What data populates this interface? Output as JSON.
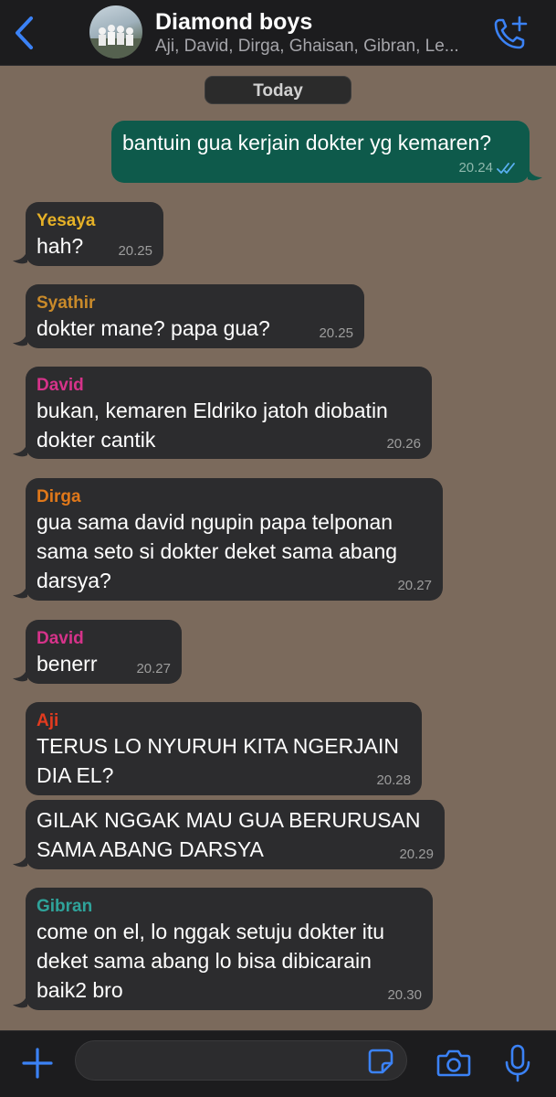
{
  "header": {
    "title": "Diamond boys",
    "subtitle": "Aji, David, Dirga, Ghaisan, Gibran, Le..."
  },
  "date_divider": "Today",
  "colors": {
    "accent": "#3b82f6",
    "yesaya": "#e6b127",
    "syathir": "#c98a2a",
    "david": "#d6338a",
    "dirga": "#e0781a",
    "aji": "#e23b1f",
    "gibran": "#2fa39a"
  },
  "messages": [
    {
      "id": "m1",
      "direction": "outgoing",
      "text": "bantuin gua kerjain dokter yg kemaren?",
      "time": "20.24",
      "status": "read"
    },
    {
      "id": "m2",
      "direction": "incoming",
      "sender": "Yesaya",
      "text": "hah?",
      "time": "20.25"
    },
    {
      "id": "m3",
      "direction": "incoming",
      "sender": "Syathir",
      "text": "dokter mane? papa gua?",
      "time": "20.25"
    },
    {
      "id": "m4",
      "direction": "incoming",
      "sender": "David",
      "text": "bukan, kemaren Eldriko jatoh diobatin\ndokter cantik",
      "time": "20.26"
    },
    {
      "id": "m5",
      "direction": "incoming",
      "sender": "Dirga",
      "text": "gua sama david ngupin papa telponan\nsama seto si dokter deket sama abang\ndarsya?",
      "time": "20.27"
    },
    {
      "id": "m6",
      "direction": "incoming",
      "sender": "David",
      "text": "benerr",
      "time": "20.27"
    },
    {
      "id": "m7",
      "direction": "incoming",
      "sender": "Aji",
      "text": "TERUS LO NYURUH KITA NGERJAIN\nDIA EL?",
      "time": "20.28"
    },
    {
      "id": "m8",
      "direction": "incoming",
      "text": "GILAK NGGAK MAU GUA BERURUSAN\nSAMA ABANG DARSYA",
      "time": "20.29"
    },
    {
      "id": "m9",
      "direction": "incoming",
      "sender": "Gibran",
      "text": "come on el, lo nggak setuju dokter itu\ndeket sama abang lo bisa dibicarain\nbaik2 bro",
      "time": "20.30"
    }
  ],
  "input": {
    "placeholder": "",
    "value": ""
  },
  "icons": {
    "back": "chevron-left-icon",
    "call": "add-call-icon",
    "plus": "plus-icon",
    "sticker": "sticker-icon",
    "camera": "camera-icon",
    "mic": "microphone-icon"
  }
}
